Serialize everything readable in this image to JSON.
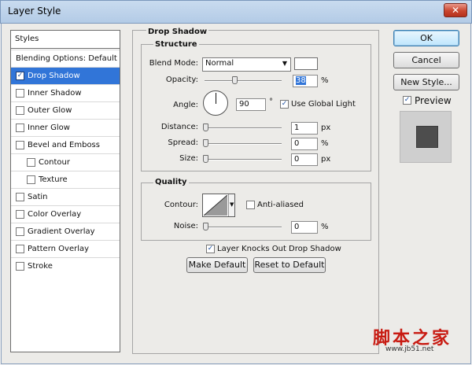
{
  "window": {
    "title": "Layer Style",
    "close_glyph": "✕"
  },
  "styles_list": {
    "header": "Styles",
    "items": [
      {
        "label": "Blending Options: Default",
        "checkbox": false,
        "checked": false,
        "selected": false,
        "indent": false
      },
      {
        "label": "Drop Shadow",
        "checkbox": true,
        "checked": true,
        "selected": true,
        "indent": false
      },
      {
        "label": "Inner Shadow",
        "checkbox": true,
        "checked": false,
        "selected": false,
        "indent": false
      },
      {
        "label": "Outer Glow",
        "checkbox": true,
        "checked": false,
        "selected": false,
        "indent": false
      },
      {
        "label": "Inner Glow",
        "checkbox": true,
        "checked": false,
        "selected": false,
        "indent": false
      },
      {
        "label": "Bevel and Emboss",
        "checkbox": true,
        "checked": false,
        "selected": false,
        "indent": false
      },
      {
        "label": "Contour",
        "checkbox": true,
        "checked": false,
        "selected": false,
        "indent": true
      },
      {
        "label": "Texture",
        "checkbox": true,
        "checked": false,
        "selected": false,
        "indent": true
      },
      {
        "label": "Satin",
        "checkbox": true,
        "checked": false,
        "selected": false,
        "indent": false
      },
      {
        "label": "Color Overlay",
        "checkbox": true,
        "checked": false,
        "selected": false,
        "indent": false
      },
      {
        "label": "Gradient Overlay",
        "checkbox": true,
        "checked": false,
        "selected": false,
        "indent": false
      },
      {
        "label": "Pattern Overlay",
        "checkbox": true,
        "checked": false,
        "selected": false,
        "indent": false
      },
      {
        "label": "Stroke",
        "checkbox": true,
        "checked": false,
        "selected": false,
        "indent": false
      }
    ]
  },
  "drop_shadow": {
    "title": "Drop Shadow",
    "structure": {
      "title": "Structure",
      "blend_mode_label": "Blend Mode:",
      "blend_mode_value": "Normal",
      "shadow_color": "#ffffff",
      "opacity_label": "Opacity:",
      "opacity_value": "38",
      "opacity_unit": "%",
      "opacity_level": 0.38,
      "angle_label": "Angle:",
      "angle_value": "90",
      "angle_unit": "°",
      "use_global_light_label": "Use Global Light",
      "use_global_light": true,
      "distance_label": "Distance:",
      "distance_value": "1",
      "distance_unit": "px",
      "spread_label": "Spread:",
      "spread_value": "0",
      "spread_unit": "%",
      "size_label": "Size:",
      "size_value": "0",
      "size_unit": "px"
    },
    "quality": {
      "title": "Quality",
      "contour_label": "Contour:",
      "anti_aliased_label": "Anti-aliased",
      "anti_aliased": false,
      "noise_label": "Noise:",
      "noise_value": "0",
      "noise_unit": "%"
    },
    "knockout_label": "Layer Knocks Out Drop Shadow",
    "knockout": true,
    "make_default_label": "Make Default",
    "reset_default_label": "Reset to Default"
  },
  "buttons": {
    "ok_label": "OK",
    "cancel_label": "Cancel",
    "new_style_label": "New Style...",
    "preview_label": "Preview",
    "preview_checked": true
  },
  "preview_swatch_color": "#4d4d4d",
  "accent_color": "#3175d8",
  "watermark": {
    "cn": "脚本之家",
    "url": "www.jb51.net"
  },
  "icons": {
    "checkmark": "✓",
    "dropdown": "▼"
  }
}
